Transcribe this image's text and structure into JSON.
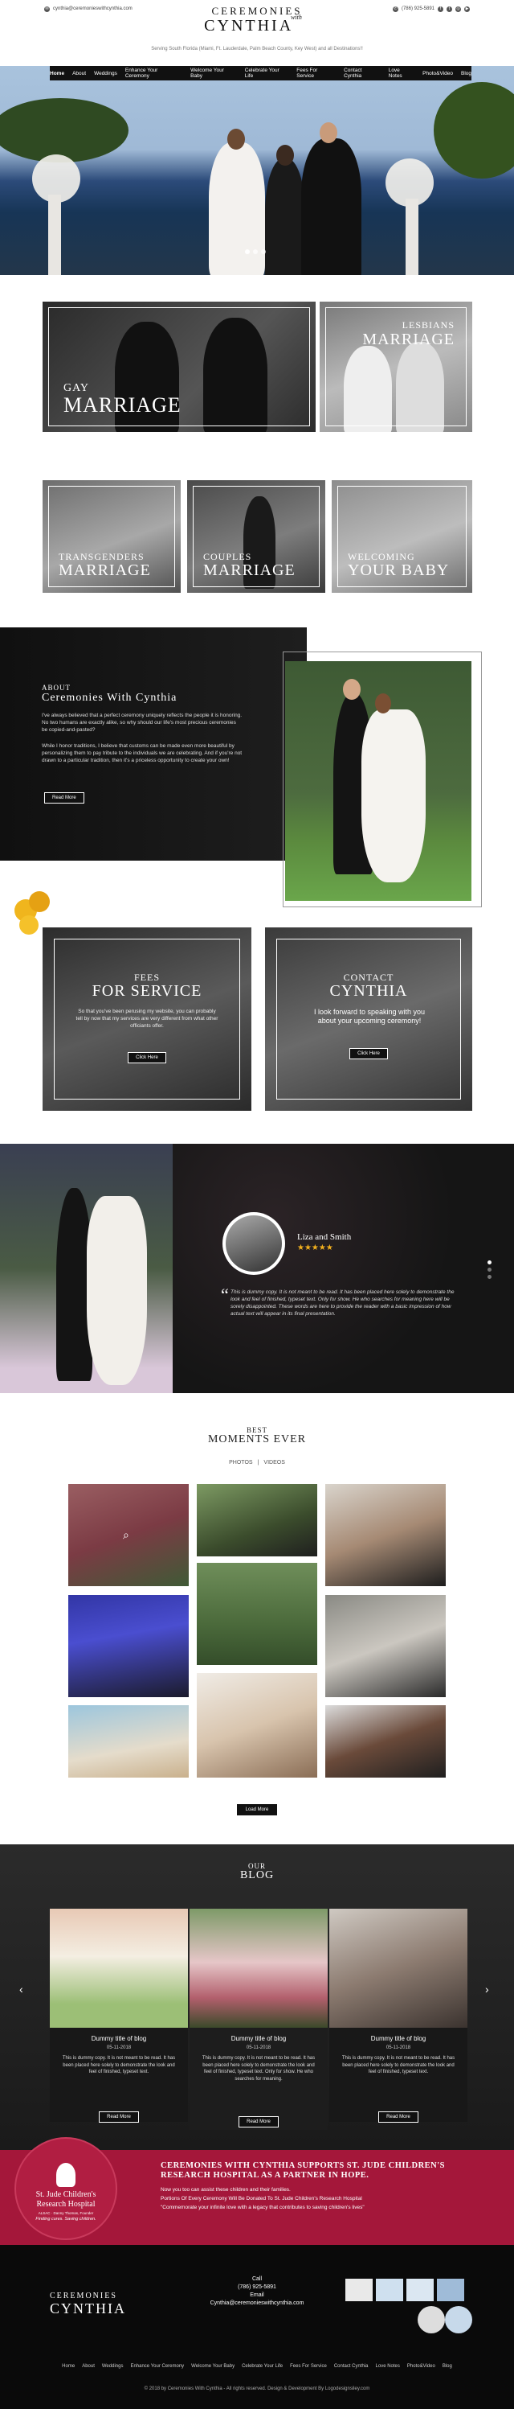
{
  "topbar": {
    "email": "cynthia@ceremonieswithcynthia.com",
    "phone": "(786) 925-5891",
    "social_icons": [
      "facebook-icon",
      "twitter-icon",
      "instagram-icon",
      "youtube-icon"
    ]
  },
  "logo": {
    "line1": "Ceremonies",
    "with": "with",
    "line2": "Cynthia"
  },
  "tagline": "Serving South Florida (Miami, Ft. Lauderdale, Palm Beach County, Key West) and all Destinations!!",
  "nav": [
    "Home",
    "About",
    "Weddings",
    "Enhance Your Ceremony",
    "Welcome Your Baby",
    "Celebrate Your Life",
    "Fees For Service",
    "Contact Cynthia",
    "Love Notes",
    "Photo&Video",
    "Blog"
  ],
  "tiles": {
    "gay": {
      "small": "Gay",
      "big": "Marriage"
    },
    "lesbians": {
      "small": "Lesbians",
      "big": "Marriage"
    },
    "transgenders": {
      "small": "Transgenders",
      "big": "Marriage"
    },
    "couples": {
      "small": "Couples",
      "big": "Marriage"
    },
    "welcoming": {
      "small": "Welcoming",
      "big": "Your Baby"
    }
  },
  "about": {
    "kicker": "About",
    "title": "Ceremonies With Cynthia",
    "p1": "I've always believed that a perfect ceremony uniquely reflects the people it is honoring. No two humans are exactly alike, so why should our life's most precious ceremonies be copied-and-pasted?",
    "p2": "While I honor traditions, I believe that customs can be made even more beautiful by personalizing them to pay tribute to the individuals we are celebrating. And if you're not drawn to a particular tradition, then it's a priceless opportunity to create your own!",
    "button": "Read More"
  },
  "fees": {
    "small": "Fees",
    "big": "For Service",
    "text": "So that you've been perusing my website, you can probably tell by now that my services are very different from what other officiants offer.",
    "button": "Click Here"
  },
  "contact": {
    "small": "Contact",
    "big": "Cynthia",
    "text": "I look forward to speaking with you about your upcoming ceremony!",
    "button": "Click Here"
  },
  "testimonial": {
    "name": "Liza and Smith",
    "stars": "★★★★★",
    "quote": "This is dummy copy. It is not meant to be read. It has been placed here solely to demonstrate the look and feel of finished, typeset text. Only for show. He who searches for meaning here will be sorely disappointed. These words are here to provide the reader with a basic impression of how actual text will appear in its final presentation."
  },
  "moments": {
    "small": "Best",
    "big": "Moments Ever",
    "tabs": [
      "PHOTOS",
      "|",
      "VIDEOS"
    ],
    "button": "Load More"
  },
  "blog": {
    "small": "Our",
    "big": "Blog",
    "posts": [
      {
        "title": "Dummy title of blog",
        "date": "05-11-2018",
        "text": "This is dummy copy. It is not meant to be read. It has been placed here solely to demonstrate the look and feel of finished, typeset text.",
        "button": "Read More"
      },
      {
        "title": "Dummy title of blog",
        "date": "05-11-2018",
        "text": "This is dummy copy. It is not meant to be read. It has been placed here solely to demonstrate the look and feel of finished, typeset text. Only for show. He who searches for meaning.",
        "button": "Read More"
      },
      {
        "title": "Dummy title of blog",
        "date": "05-11-2018",
        "text": "This is dummy copy. It is not meant to be read. It has been placed here solely to demonstrate the look and feel of finished, typeset text.",
        "button": "Read More"
      }
    ]
  },
  "stjude": {
    "logo_line1": "St. Jude Children's",
    "logo_line2": "Research Hospital",
    "logo_line3": "ALSAC · Danny Thomas, Founder",
    "logo_line4": "Finding cures. Saving children.",
    "heading": "Ceremonies With Cynthia Supports St. Jude Children's Research Hospital As A Partner In Hope.",
    "l1": "Now you too can assist these children and their families.",
    "l2": "Portions Of Every Ceremony Will Be Donated To St. Jude Children's Research Hospital",
    "l3": "\"Commemorate your infinite love with a legacy that contributes to saving children's lives\""
  },
  "footer": {
    "call_label": "Call",
    "phone": "(786) 925-5891",
    "email_label": "Email",
    "email": "Cynthia@ceremonieswithcynthia.com",
    "links": [
      "Home",
      "About",
      "Weddings",
      "Enhance Your Ceremony",
      "Welcome Your Baby",
      "Celebrate Your Life",
      "Fees For Service",
      "Contact Cynthia",
      "Love Notes",
      "Photo&Video",
      "Blog"
    ],
    "copyright": "© 2018 by Ceremonies With Cynthia - All rights reserved. Design & Development By Logodesignsiley.com"
  }
}
